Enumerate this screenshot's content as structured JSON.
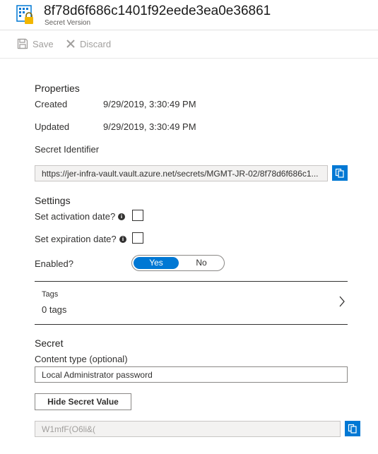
{
  "header": {
    "title": "8f78d6f686c1401f92eede3ea0e36861",
    "subtitle": "Secret Version",
    "icon": "key-vault-secret-icon"
  },
  "toolbar": {
    "save_label": "Save",
    "discard_label": "Discard"
  },
  "properties": {
    "heading": "Properties",
    "created_label": "Created",
    "created_value": "9/29/2019, 3:30:49 PM",
    "updated_label": "Updated",
    "updated_value": "9/29/2019, 3:30:49 PM",
    "identifier_label": "Secret Identifier",
    "identifier_value": "https://jer-infra-vault.vault.azure.net/secrets/MGMT-JR-02/8f78d6f686c1..."
  },
  "settings": {
    "heading": "Settings",
    "activation_label": "Set activation date?",
    "expiration_label": "Set expiration date?",
    "enabled_label": "Enabled?",
    "enabled_yes": "Yes",
    "enabled_no": "No",
    "enabled_value": "Yes"
  },
  "tags": {
    "label": "Tags",
    "value": "0 tags"
  },
  "secret": {
    "heading": "Secret",
    "content_type_label": "Content type (optional)",
    "content_type_value": "Local Administrator password",
    "hide_button_label": "Hide Secret Value",
    "secret_value": "W1mfF(O6li&("
  },
  "colors": {
    "accent": "#0078d4",
    "lock": "#f2b600"
  }
}
